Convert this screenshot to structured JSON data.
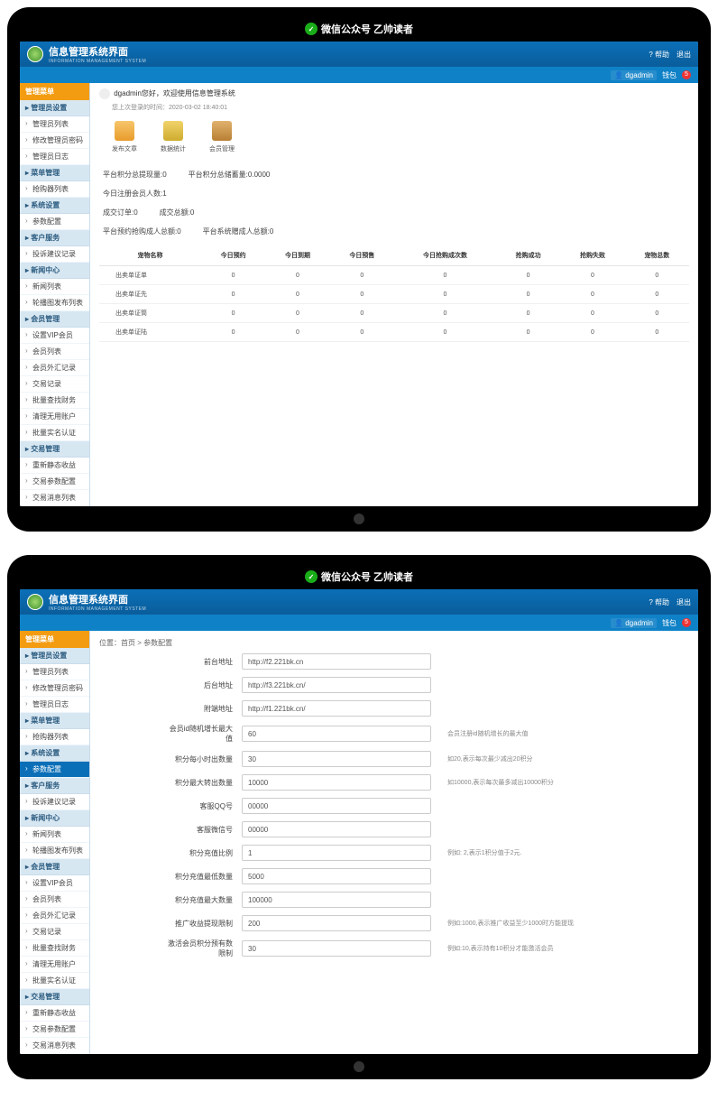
{
  "watermark": {
    "label": "微信公众号 乙帅读者"
  },
  "header": {
    "title": "信息管理系统界面",
    "subtitle": "INFORMATION MANAGEMENT SYSTEM",
    "help": "? 帮助",
    "logout": "退出"
  },
  "subheader": {
    "user_prefix": "👤 dgadmin",
    "money_label": "钱包",
    "money_badge": "5"
  },
  "sidebar": {
    "menu_head": "管理菜单",
    "groups1": [
      {
        "title": "管理员设置",
        "items": [
          "管理员列表",
          "修改管理员密码",
          "管理员日志"
        ]
      },
      {
        "title": "菜单管理",
        "items": [
          "抢购器列表"
        ]
      },
      {
        "title": "系统设置",
        "items": [
          "参数配置"
        ]
      },
      {
        "title": "客户服务",
        "items": [
          "投诉建议记录"
        ]
      },
      {
        "title": "新闻中心",
        "items": [
          "新闻列表",
          "轮播图发布列表"
        ]
      },
      {
        "title": "会员管理",
        "items": [
          "设置VIP会员",
          "会员列表",
          "会员外汇记录",
          "交易记录",
          "批量查找财务",
          "清理无用账户",
          "批量实名认证"
        ]
      },
      {
        "title": "交易管理",
        "items": [
          "重新静态收益",
          "交易参数配置",
          "交易消息列表",
          ""
        ]
      }
    ],
    "groups2": [
      {
        "title": "管理员设置",
        "items": [
          "管理员列表",
          "修改管理员密码",
          "管理员日志"
        ]
      },
      {
        "title": "菜单管理",
        "items": [
          "抢购器列表"
        ]
      },
      {
        "title": "系统设置",
        "items": [
          "参数配置"
        ]
      },
      {
        "title": "客户服务",
        "items": [
          "投诉建议记录"
        ]
      },
      {
        "title": "新闻中心",
        "items": [
          "新闻列表",
          "轮播图发布列表"
        ]
      },
      {
        "title": "会员管理",
        "items": [
          "设置VIP会员",
          "会员列表",
          "会员外汇记录",
          "交易记录",
          "批量查找财务",
          "清理无用账户",
          "批量实名认证"
        ]
      },
      {
        "title": "交易管理",
        "items": [
          "重新静态收益",
          "交易参数配置",
          "交易消息列表"
        ]
      }
    ],
    "active2": "参数配置"
  },
  "screen1": {
    "welcome": "dgadmin您好，欢迎使用信息管理系统",
    "login_time_label": "您上次登录的时间：2020-03-02 18:40:01",
    "quick": [
      {
        "label": "发布文章",
        "color": "orange"
      },
      {
        "label": "数据统计",
        "color": "yellow"
      },
      {
        "label": "会员管理",
        "color": "brown"
      }
    ],
    "stats": [
      [
        "平台积分总提现量:0",
        "平台积分总储蓄量:0.0000"
      ],
      [
        "今日注册会员人数:1"
      ],
      [
        "成交订单:0",
        "成交总额:0"
      ],
      [
        "平台预约抢购成人总额:0",
        "平台系统赠成人总额:0"
      ]
    ],
    "table": {
      "headers": [
        "宠物名称",
        "今日预约",
        "今日到期",
        "今日预售",
        "今日抢购成次数",
        "抢购成功",
        "抢购失败",
        "宠物总数"
      ],
      "rows": [
        [
          "出卖单证单",
          "0",
          "0",
          "0",
          "0",
          "0",
          "0",
          "0"
        ],
        [
          "出卖单证先",
          "0",
          "0",
          "0",
          "0",
          "0",
          "0",
          "0"
        ],
        [
          "出卖单证筒",
          "0",
          "0",
          "0",
          "0",
          "0",
          "0",
          "0"
        ],
        [
          "出卖单证陆",
          "0",
          "0",
          "0",
          "0",
          "0",
          "0",
          "0"
        ]
      ]
    }
  },
  "screen2": {
    "breadcrumb": "位置：首页 > 参数配置",
    "fields": [
      {
        "label": "前台地址",
        "value": "http://f2.221bk.cn",
        "hint": ""
      },
      {
        "label": "后台地址",
        "value": "http://f3.221bk.cn/",
        "hint": ""
      },
      {
        "label": "附端地址",
        "value": "http://f1.221bk.cn/",
        "hint": ""
      },
      {
        "label": "会员id随机增长最大值",
        "value": "60",
        "hint": "会员注册id随机增长的最大值"
      },
      {
        "label": "积分每小时出数量",
        "value": "30",
        "hint": "如20,表示每次最少减出20积分"
      },
      {
        "label": "积分最大转出数量",
        "value": "10000",
        "hint": "如10000,表示每次最多减出10000积分"
      },
      {
        "label": "客服QQ号",
        "value": "00000",
        "hint": ""
      },
      {
        "label": "客服微信号",
        "value": "00000",
        "hint": ""
      },
      {
        "label": "积分充值比例",
        "value": "1",
        "hint": "例如: 2,表示1积分值于2元."
      },
      {
        "label": "积分充值最低数量",
        "value": "5000",
        "hint": ""
      },
      {
        "label": "积分充值最大数量",
        "value": "100000",
        "hint": ""
      },
      {
        "label": "推广收益提现限制",
        "value": "200",
        "hint": "例如:1000,表示推广收益至少1000时方能提现"
      },
      {
        "label": "激活会员积分预有数限制",
        "value": "30",
        "hint": "例如:10,表示持有10积分才能激活会员"
      }
    ]
  }
}
